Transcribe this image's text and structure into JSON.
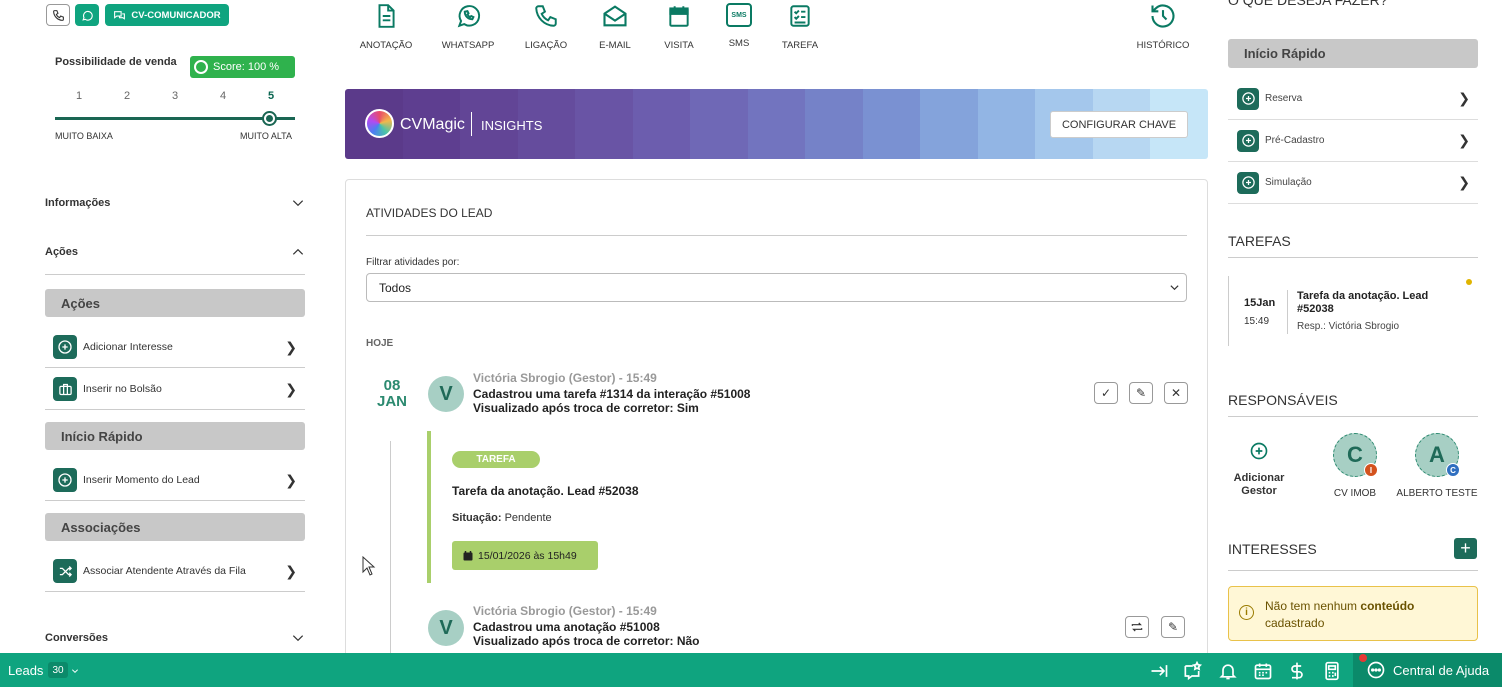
{
  "left": {
    "top_buttons": {
      "communicator_label": "CV-COMUNICADOR"
    },
    "sale": {
      "title": "Possibilidade de venda",
      "score_label": "Score: 100 %",
      "scale": [
        "1",
        "2",
        "3",
        "4",
        "5"
      ],
      "selected": 5,
      "low_label": "MUITO BAIXA",
      "high_label": "MUITO ALTA"
    },
    "accordions": {
      "info": "Informações",
      "actions": "Ações",
      "conversions": "Conversões"
    },
    "groups": [
      {
        "title": "Ações",
        "items": [
          "Adicionar Interesse",
          "Inserir no Bolsão"
        ]
      },
      {
        "title": "Início Rápido",
        "items": [
          "Inserir Momento do Lead"
        ]
      },
      {
        "title": "Associações",
        "items": [
          "Associar Atendente Através da Fila"
        ]
      }
    ]
  },
  "toolbar": {
    "items": [
      "ANOTAÇÃO",
      "WHATSAPP",
      "LIGAÇÃO",
      "E-MAIL",
      "VISITA",
      "SMS",
      "TAREFA"
    ],
    "history": "HISTÓRICO",
    "sms_glyph": "SMS"
  },
  "banner": {
    "brand": "CVMagic",
    "product": "INSIGHTS",
    "button": "CONFIGURAR CHAVE"
  },
  "activities": {
    "title": "ATIVIDADES DO LEAD",
    "filter_label": "Filtrar atividades por:",
    "filter_value": "Todos",
    "today": "HOJE",
    "date_day": "08",
    "date_month": "JAN",
    "entries": [
      {
        "avatar": "V",
        "author": "Victória Sbrogio (Gestor) - 15:49",
        "line1": "Cadastrou uma tarefa #1314 da interação #51008",
        "line2": "Visualizado após troca de corretor:  Sim"
      },
      {
        "avatar": "V",
        "author": "Victória Sbrogio (Gestor) - 15:49",
        "line1": "Cadastrou uma anotação #51008",
        "line2": "Visualizado após troca de corretor:  Não"
      }
    ],
    "task": {
      "badge": "TAREFA",
      "title": "Tarefa da anotação. Lead #52038",
      "status_label": "Situação:",
      "status_value": "Pendente",
      "due": "15/01/2026 às 15h49"
    }
  },
  "right": {
    "header_partial": "O QUE DESEJA FAZER?",
    "quick_start": {
      "title": "Início Rápido",
      "items": [
        "Reserva",
        "Pré-Cadastro",
        "Simulação"
      ]
    },
    "tasks": {
      "title": "TAREFAS",
      "day": "15Jan",
      "time": "15:49",
      "title_text": "Tarefa da anotação. Lead #52038",
      "resp": "Resp.: Victória Sbrogio"
    },
    "responsibles": {
      "title": "RESPONSÁVEIS",
      "add_label_1": "Adicionar",
      "add_label_2": "Gestor",
      "people": [
        {
          "initial": "C",
          "name": "CV IMOB",
          "badge": "I"
        },
        {
          "initial": "A",
          "name": "ALBERTO TESTE",
          "badge": "C"
        }
      ]
    },
    "interests": {
      "title": "INTERESSES",
      "notice_prefix": "Não tem nenhum ",
      "notice_bold": "conteúdo",
      "notice_suffix": "cadastrado"
    }
  },
  "bottom": {
    "leads_label": "Leads",
    "leads_count": "30",
    "help": "Central de Ajuda"
  },
  "colors": {
    "primary": "#0fa47f",
    "dark_green": "#1d6b5a",
    "banner_start": "#5b3a8a",
    "banner_end": "#c6e6f8",
    "task_green": "#a9cf6b"
  }
}
